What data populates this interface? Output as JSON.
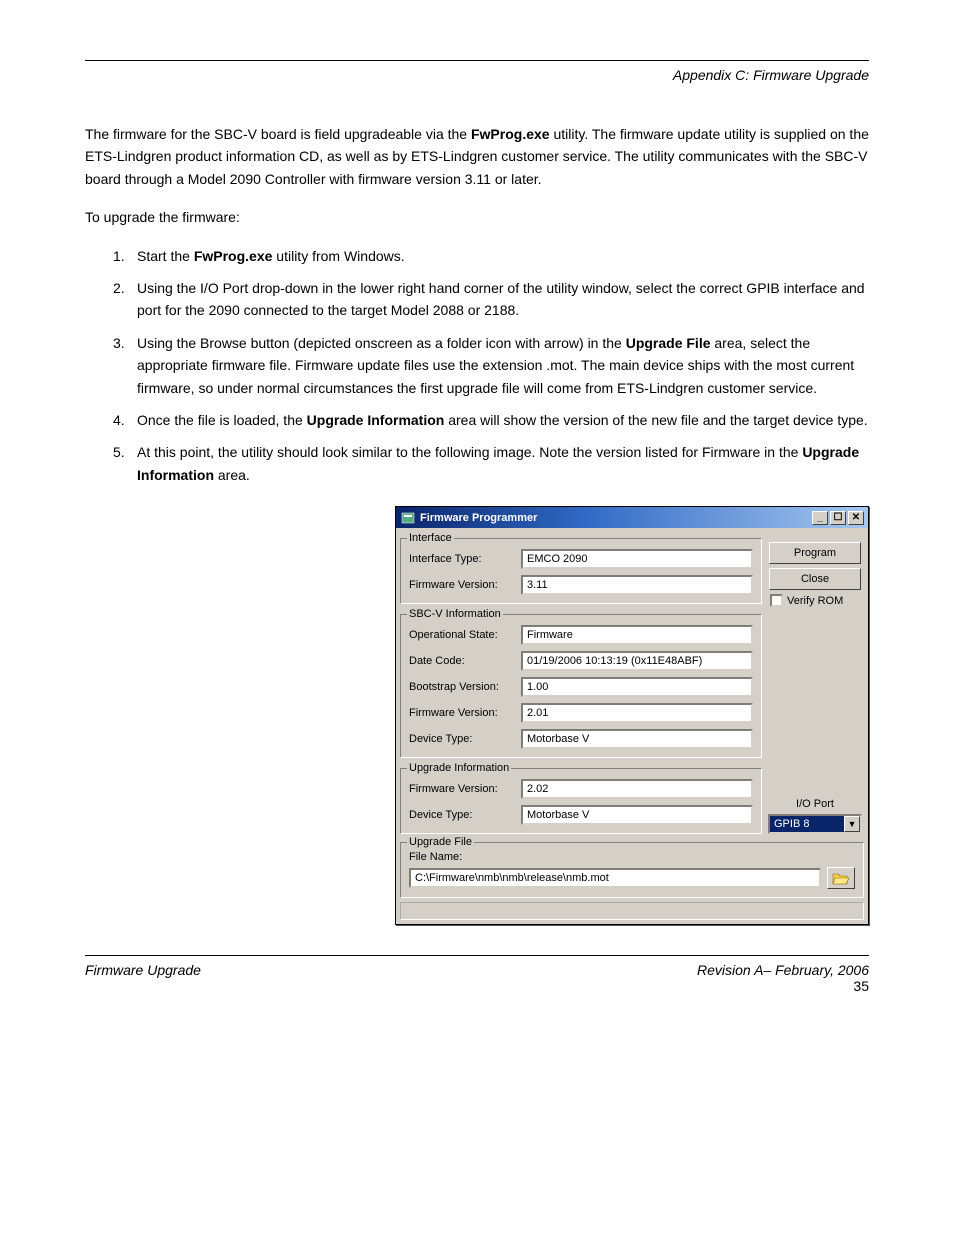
{
  "page": {
    "top_heading_right": "Appendix C: Firmware Upgrade",
    "para1_a": "The firmware for the SBC-V board is field upgradeable via the ",
    "para1_b": "FwProg.exe",
    "para1_c": " utility. The firmware update utility is supplied on the ETS-Lindgren product information CD, as well as by ETS-Lindgren customer service. The utility communicates with the SBC-V board through a Model 2090 Controller with firmware version 3.11 or later.",
    "para2": "To upgrade the firmware:",
    "step1_a": "Start the ",
    "step1_b": "FwProg.exe",
    "step1_c": " utility from Windows.",
    "step2": "Using the I/O Port drop-down in the lower right hand corner of the utility window, select the correct GPIB interface and port for the 2090 connected to the target Model 2088 or 2188.",
    "step3_a": "Using the Browse button (depicted onscreen as a folder icon with arrow) in the ",
    "step3_b": "Upgrade File",
    "step3_c": " area, select the appropriate firmware file. Firmware update files use the extension .mot. The main device ships with the most current firmware, so under normal circumstances the first upgrade file will come from ETS-Lindgren customer service.",
    "step4_a": "Once the file is loaded, the ",
    "step4_b": "Upgrade Information",
    "step4_c": " area will show the version of the new file and the target device type.",
    "step5_a": "At this point, the utility should look similar to the following image. Note the version listed for Firmware in the ",
    "step5_b": "Upgrade Information",
    "step5_c": " area.",
    "footer_left": "Firmware Upgrade",
    "footer_right_line1": "Revision A– February, 2006",
    "footer_right_line2": "35"
  },
  "win": {
    "title": "Firmware Programmer",
    "btn_program": "Program",
    "btn_close": "Close",
    "verify_rom": "Verify ROM",
    "ioport_label": "I/O Port",
    "ioport_value": "GPIB 8",
    "groups": {
      "interface": {
        "title": "Interface",
        "rows": {
          "type_label": "Interface Type:",
          "type_value": "EMCO 2090",
          "fw_label": "Firmware Version:",
          "fw_value": "3.11"
        }
      },
      "sbcv": {
        "title": "SBC-V Information",
        "rows": {
          "opstate_label": "Operational State:",
          "opstate_value": "Firmware",
          "date_label": "Date Code:",
          "date_value": "01/19/2006 10:13:19 (0x11E48ABF)",
          "boot_label": "Bootstrap Version:",
          "boot_value": "1.00",
          "fw_label": "Firmware Version:",
          "fw_value": "2.01",
          "dev_label": "Device Type:",
          "dev_value": "Motorbase V"
        }
      },
      "upgrade": {
        "title": "Upgrade Information",
        "rows": {
          "fw_label": "Firmware Version:",
          "fw_value": "2.02",
          "dev_label": "Device Type:",
          "dev_value": "Motorbase V"
        }
      },
      "file": {
        "title": "Upgrade File",
        "filename_label": "File Name:",
        "path": "C:\\Firmware\\nmb\\nmb\\release\\nmb.mot"
      }
    }
  }
}
